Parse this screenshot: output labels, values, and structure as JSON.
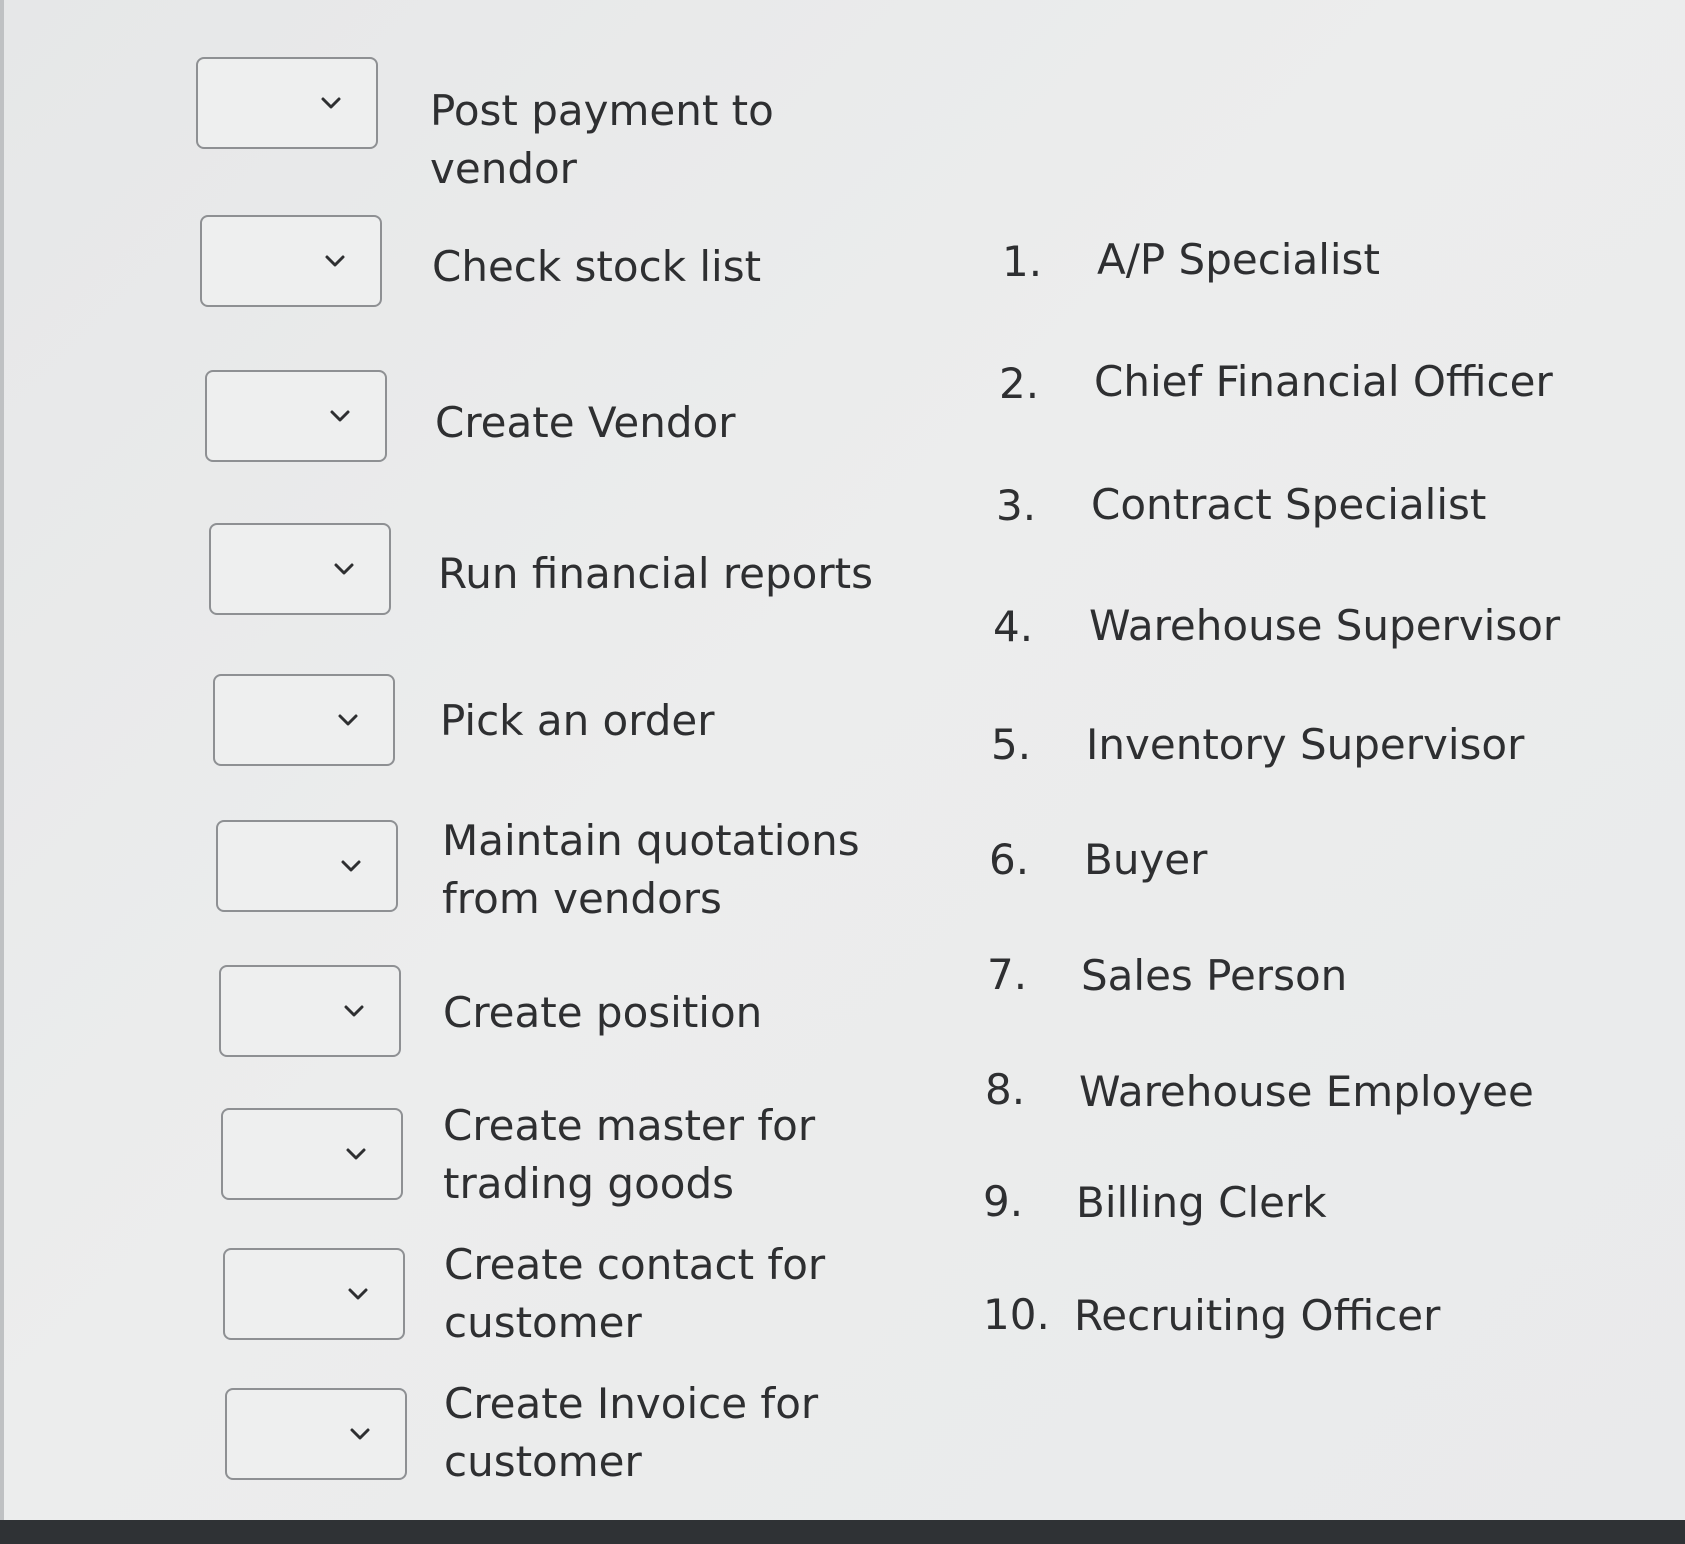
{
  "tasks": [
    {
      "label": "Post payment to vendor",
      "selected": ""
    },
    {
      "label": "Check stock list",
      "selected": ""
    },
    {
      "label": "Create Vendor",
      "selected": ""
    },
    {
      "label": "Run financial reports",
      "selected": ""
    },
    {
      "label": "Pick an order",
      "selected": ""
    },
    {
      "label": "Maintain quotations from vendors",
      "selected": ""
    },
    {
      "label": "Create position",
      "selected": ""
    },
    {
      "label": "Create master for trading goods",
      "selected": ""
    },
    {
      "label": "Create contact for customer",
      "selected": ""
    },
    {
      "label": "Create Invoice for customer",
      "selected": ""
    }
  ],
  "roles": [
    {
      "num": "1.",
      "name": "A/P Specialist"
    },
    {
      "num": "2.",
      "name": "Chief Financial Officer"
    },
    {
      "num": "3.",
      "name": "Contract Specialist"
    },
    {
      "num": "4.",
      "name": "Warehouse Supervisor"
    },
    {
      "num": "5.",
      "name": "Inventory Supervisor"
    },
    {
      "num": "6.",
      "name": "Buyer"
    },
    {
      "num": "7.",
      "name": "Sales Person"
    },
    {
      "num": "8.",
      "name": "Warehouse Employee"
    },
    {
      "num": "9.",
      "name": "Billing Clerk"
    },
    {
      "num": "10.",
      "name": "Recruiting Officer"
    }
  ],
  "icons": {
    "dropdown": "chevron-down-icon"
  }
}
